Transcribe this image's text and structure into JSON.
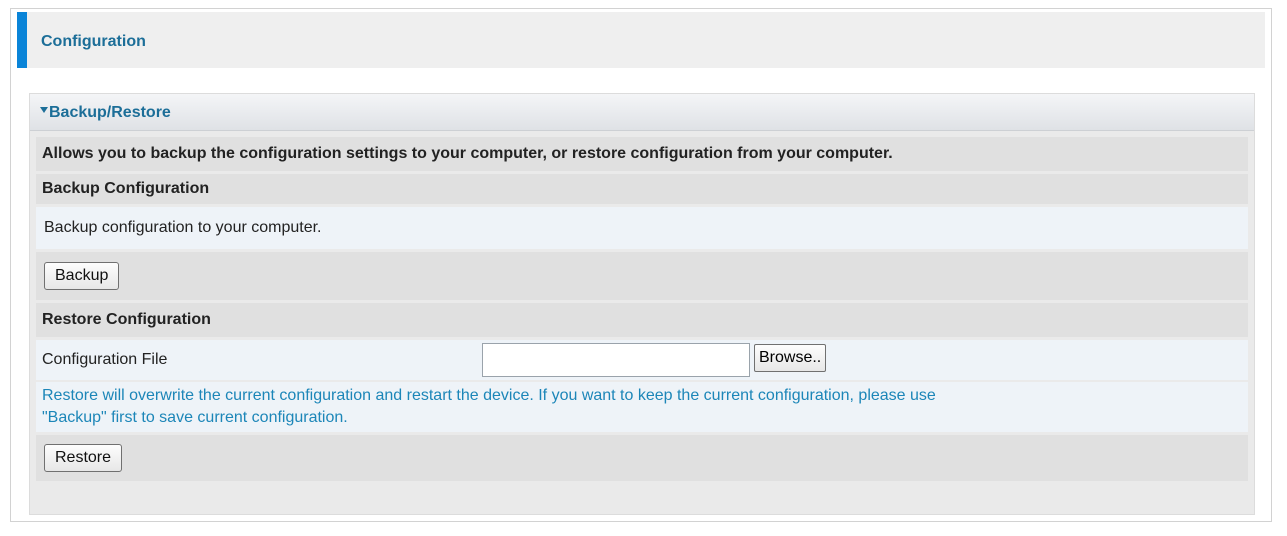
{
  "header": {
    "title": "Configuration"
  },
  "section": {
    "title": "Backup/Restore",
    "description": "Allows you to backup the configuration settings to your computer, or restore configuration from your computer.",
    "backup": {
      "heading": "Backup Configuration",
      "description": "Backup configuration to your computer.",
      "button_label": "Backup"
    },
    "restore": {
      "heading": "Restore Configuration",
      "file_label": "Configuration File",
      "file_value": "",
      "browse_label": "Browse..",
      "warning_line1": "Restore will overwrite the current configuration and restart the device. If you want to keep the current configuration, please use",
      "warning_line2": "\"Backup\" first to save current configuration.",
      "button_label": "Restore"
    }
  },
  "colors": {
    "accent": "#0a84d8",
    "title_text": "#1c6e98",
    "warning_text": "#1c86b8"
  }
}
